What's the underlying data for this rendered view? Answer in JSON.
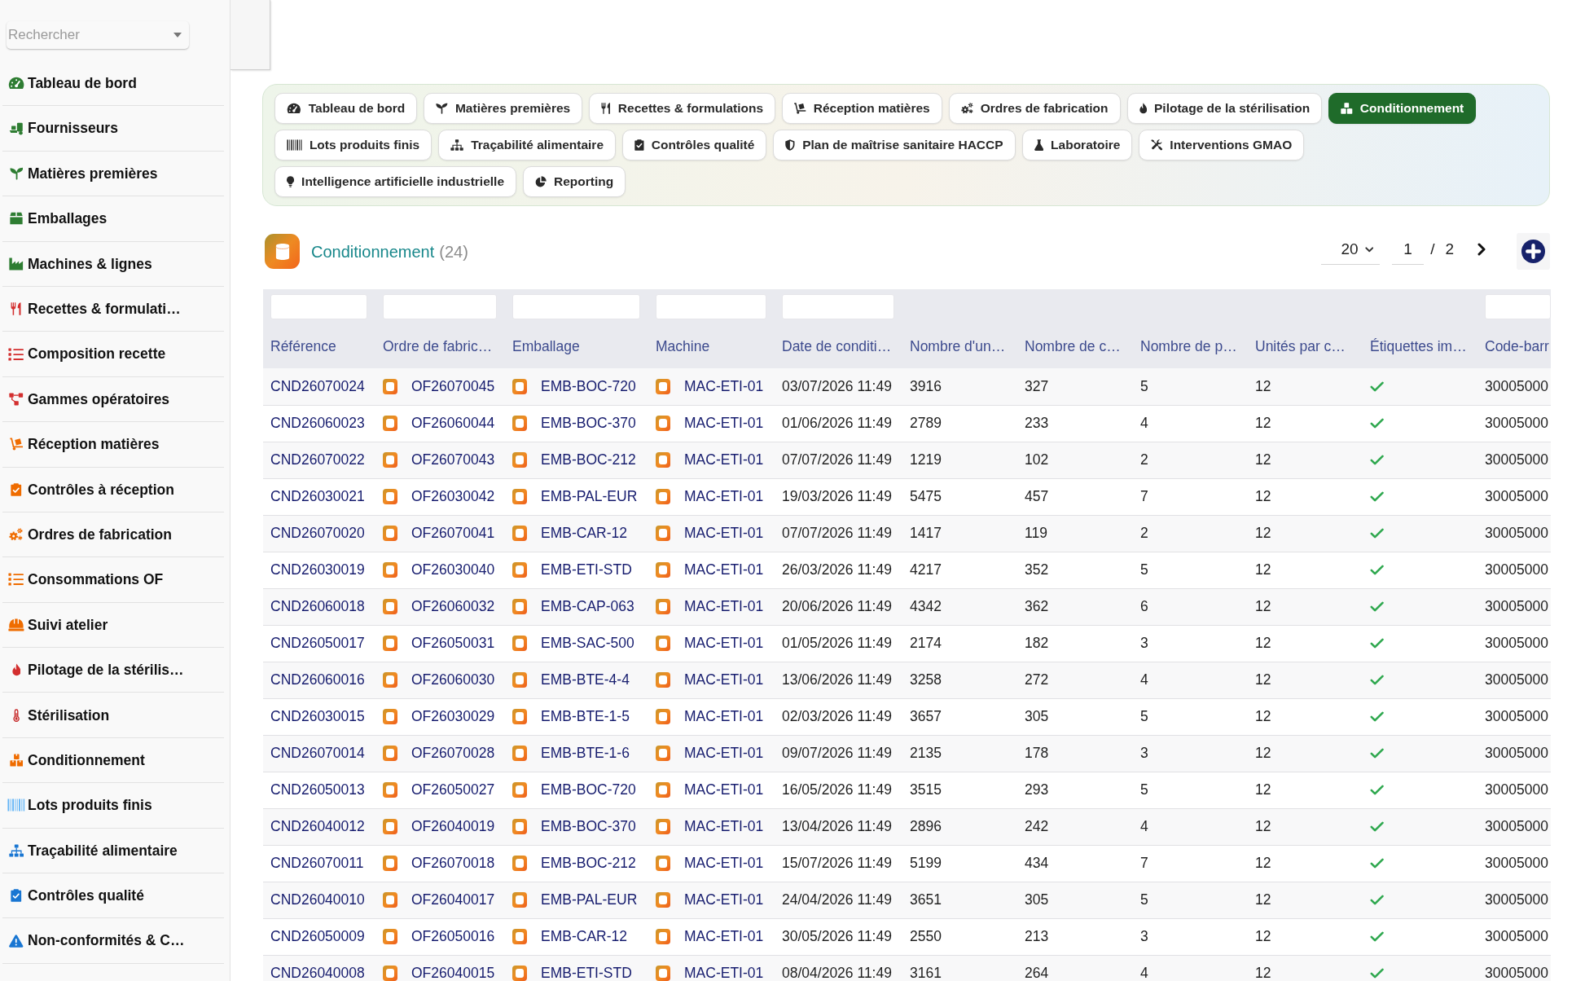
{
  "sidebar": {
    "search": {
      "placeholder": "Rechercher"
    },
    "items": [
      {
        "label": "Tableau de bord",
        "color": "#2e7d32"
      },
      {
        "label": "Fournisseurs",
        "color": "#2e7d32"
      },
      {
        "label": "Matières premières",
        "color": "#2e7d32"
      },
      {
        "label": "Emballages",
        "color": "#2e7d32"
      },
      {
        "label": "Machines & lignes",
        "color": "#2e7d32"
      },
      {
        "label": "Recettes & formulati…",
        "color": "#d32f2f"
      },
      {
        "label": "Composition recette",
        "color": "#d32f2f"
      },
      {
        "label": "Gammes opératoires",
        "color": "#d32f2f"
      },
      {
        "label": "Réception matières",
        "color": "#ef6c00"
      },
      {
        "label": "Contrôles à réception",
        "color": "#ef6c00"
      },
      {
        "label": "Ordres de fabrication",
        "color": "#ef6c00"
      },
      {
        "label": "Consommations OF",
        "color": "#ef6c00"
      },
      {
        "label": "Suivi atelier",
        "color": "#ef6c00"
      },
      {
        "label": "Pilotage de la stérilis…",
        "color": "#d32f2f"
      },
      {
        "label": "Stérilisation",
        "color": "#c62828"
      },
      {
        "label": "Conditionnement",
        "color": "#ef6c00"
      },
      {
        "label": "Lots produits finis",
        "color": "#64b5f6"
      },
      {
        "label": "Traçabilité alimentaire",
        "color": "#1976d2"
      },
      {
        "label": "Contrôles qualité",
        "color": "#1976d2"
      },
      {
        "label": "Non-conformités & C…",
        "color": "#1976d2"
      }
    ]
  },
  "tabs": [
    {
      "label": "Tableau de bord",
      "selected": false
    },
    {
      "label": "Matières premières",
      "selected": false
    },
    {
      "label": "Recettes & formulations",
      "selected": false
    },
    {
      "label": "Réception matières",
      "selected": false
    },
    {
      "label": "Ordres de fabrication",
      "selected": false
    },
    {
      "label": "Pilotage de la stérilisation",
      "selected": false
    },
    {
      "label": "Conditionnement",
      "selected": true
    },
    {
      "label": "Lots produits finis",
      "selected": false
    },
    {
      "label": "Traçabilité alimentaire",
      "selected": false
    },
    {
      "label": "Contrôles qualité",
      "selected": false
    },
    {
      "label": "Plan de maîtrise sanitaire HACCP",
      "selected": false
    },
    {
      "label": "Laboratoire",
      "selected": false
    },
    {
      "label": "Interventions GMAO",
      "selected": false
    },
    {
      "label": "Intelligence artificielle industrielle",
      "selected": false
    },
    {
      "label": "Reporting",
      "selected": false
    }
  ],
  "module": {
    "title": "Conditionnement",
    "count": "(24)"
  },
  "pagination": {
    "page_size": "20",
    "page": "1",
    "separator": "/",
    "page_count": "2"
  },
  "table": {
    "columns": [
      {
        "label": "Référence",
        "kind": "link",
        "filter": true
      },
      {
        "label": "Ordre de fabric…",
        "kind": "icon_link",
        "filter": true
      },
      {
        "label": "Emballage",
        "kind": "icon_link",
        "filter": true
      },
      {
        "label": "Machine",
        "kind": "icon_link",
        "filter": true
      },
      {
        "label": "Date de conditi…",
        "kind": "text",
        "filter": true
      },
      {
        "label": "Nombre d'un…",
        "kind": "text",
        "filter": false
      },
      {
        "label": "Nombre de c…",
        "kind": "text",
        "filter": false
      },
      {
        "label": "Nombre de p…",
        "kind": "text",
        "filter": false
      },
      {
        "label": "Unités par c…",
        "kind": "text",
        "filter": false
      },
      {
        "label": "Étiquettes im…",
        "kind": "check",
        "filter": false
      },
      {
        "label": "Code-barr",
        "kind": "text",
        "filter": true
      }
    ],
    "rows": [
      {
        "cells": [
          "CND26070024",
          "OF26070045",
          "EMB-BOC-720",
          "MAC-ETI-01",
          "03/07/2026 11:49",
          "3916",
          "327",
          "5",
          "12",
          {
            "checked": true
          },
          "30005000"
        ]
      },
      {
        "cells": [
          "CND26060023",
          "OF26060044",
          "EMB-BOC-370",
          "MAC-ETI-01",
          "01/06/2026 11:49",
          "2789",
          "233",
          "4",
          "12",
          {
            "checked": true
          },
          "30005000"
        ]
      },
      {
        "cells": [
          "CND26070022",
          "OF26070043",
          "EMB-BOC-212",
          "MAC-ETI-01",
          "07/07/2026 11:49",
          "1219",
          "102",
          "2",
          "12",
          {
            "checked": true
          },
          "30005000"
        ]
      },
      {
        "cells": [
          "CND26030021",
          "OF26030042",
          "EMB-PAL-EUR",
          "MAC-ETI-01",
          "19/03/2026 11:49",
          "5475",
          "457",
          "7",
          "12",
          {
            "checked": true
          },
          "30005000"
        ]
      },
      {
        "cells": [
          "CND26070020",
          "OF26070041",
          "EMB-CAR-12",
          "MAC-ETI-01",
          "07/07/2026 11:49",
          "1417",
          "119",
          "2",
          "12",
          {
            "checked": true
          },
          "30005000"
        ]
      },
      {
        "cells": [
          "CND26030019",
          "OF26030040",
          "EMB-ETI-STD",
          "MAC-ETI-01",
          "26/03/2026 11:49",
          "4217",
          "352",
          "5",
          "12",
          {
            "checked": true
          },
          "30005000"
        ]
      },
      {
        "cells": [
          "CND26060018",
          "OF26060032",
          "EMB-CAP-063",
          "MAC-ETI-01",
          "20/06/2026 11:49",
          "4342",
          "362",
          "6",
          "12",
          {
            "checked": true
          },
          "30005000"
        ]
      },
      {
        "cells": [
          "CND26050017",
          "OF26050031",
          "EMB-SAC-500",
          "MAC-ETI-01",
          "01/05/2026 11:49",
          "2174",
          "182",
          "3",
          "12",
          {
            "checked": true
          },
          "30005000"
        ]
      },
      {
        "cells": [
          "CND26060016",
          "OF26060030",
          "EMB-BTE-4-4",
          "MAC-ETI-01",
          "13/06/2026 11:49",
          "3258",
          "272",
          "4",
          "12",
          {
            "checked": true
          },
          "30005000"
        ]
      },
      {
        "cells": [
          "CND26030015",
          "OF26030029",
          "EMB-BTE-1-5",
          "MAC-ETI-01",
          "02/03/2026 11:49",
          "3657",
          "305",
          "5",
          "12",
          {
            "checked": true
          },
          "30005000"
        ]
      },
      {
        "cells": [
          "CND26070014",
          "OF26070028",
          "EMB-BTE-1-6",
          "MAC-ETI-01",
          "09/07/2026 11:49",
          "2135",
          "178",
          "3",
          "12",
          {
            "checked": true
          },
          "30005000"
        ]
      },
      {
        "cells": [
          "CND26050013",
          "OF26050027",
          "EMB-BOC-720",
          "MAC-ETI-01",
          "16/05/2026 11:49",
          "3515",
          "293",
          "5",
          "12",
          {
            "checked": true
          },
          "30005000"
        ]
      },
      {
        "cells": [
          "CND26040012",
          "OF26040019",
          "EMB-BOC-370",
          "MAC-ETI-01",
          "13/04/2026 11:49",
          "2896",
          "242",
          "4",
          "12",
          {
            "checked": true
          },
          "30005000"
        ]
      },
      {
        "cells": [
          "CND26070011",
          "OF26070018",
          "EMB-BOC-212",
          "MAC-ETI-01",
          "15/07/2026 11:49",
          "5199",
          "434",
          "7",
          "12",
          {
            "checked": true
          },
          "30005000"
        ]
      },
      {
        "cells": [
          "CND26040010",
          "OF26040017",
          "EMB-PAL-EUR",
          "MAC-ETI-01",
          "24/04/2026 11:49",
          "3651",
          "305",
          "5",
          "12",
          {
            "checked": true
          },
          "30005000"
        ]
      },
      {
        "cells": [
          "CND26050009",
          "OF26050016",
          "EMB-CAR-12",
          "MAC-ETI-01",
          "30/05/2026 11:49",
          "2550",
          "213",
          "3",
          "12",
          {
            "checked": true
          },
          "30005000"
        ]
      },
      {
        "cells": [
          "CND26040008",
          "OF26040015",
          "EMB-ETI-STD",
          "MAC-ETI-01",
          "08/04/2026 11:49",
          "3161",
          "264",
          "4",
          "12",
          {
            "checked": true
          },
          "30005000"
        ]
      }
    ]
  }
}
